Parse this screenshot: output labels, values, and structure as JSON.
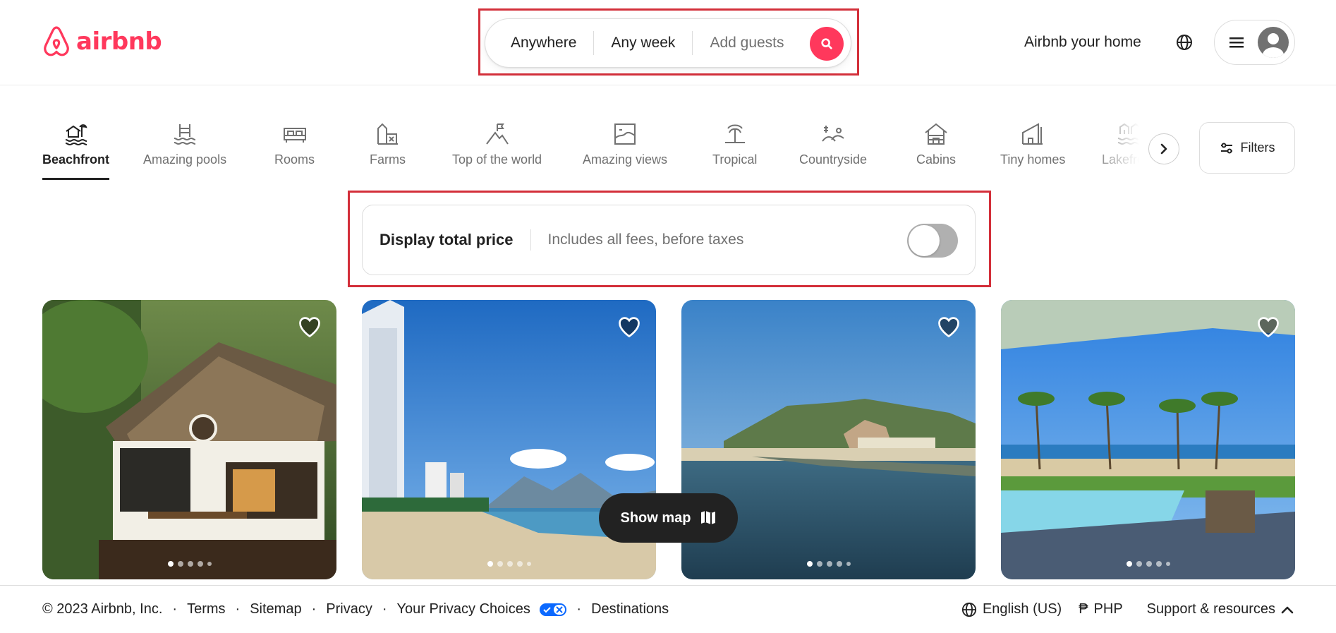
{
  "header": {
    "logo_text": "airbnb",
    "search": {
      "location": "Anywhere",
      "dates": "Any week",
      "guests": "Add guests"
    },
    "host_link": "Airbnb your home"
  },
  "categories": [
    {
      "label": "Beachfront",
      "icon": "beachfront-icon",
      "active": true
    },
    {
      "label": "Amazing pools",
      "icon": "pool-icon"
    },
    {
      "label": "Rooms",
      "icon": "bed-icon"
    },
    {
      "label": "Farms",
      "icon": "barn-icon"
    },
    {
      "label": "Top of the world",
      "icon": "mountain-flag-icon"
    },
    {
      "label": "Amazing views",
      "icon": "view-icon"
    },
    {
      "label": "Tropical",
      "icon": "palm-icon"
    },
    {
      "label": "Countryside",
      "icon": "countryside-icon"
    },
    {
      "label": "Cabins",
      "icon": "cabin-icon"
    },
    {
      "label": "Tiny homes",
      "icon": "tiny-home-icon"
    },
    {
      "label": "Lakefront",
      "icon": "lakefront-icon"
    }
  ],
  "filters_label": "Filters",
  "price_toggle": {
    "title": "Display total price",
    "subtitle": "Includes all fees, before taxes",
    "enabled": false
  },
  "listings": [
    {
      "image": "thatched-cottage-photo",
      "dots": 5
    },
    {
      "image": "beach-city-photo",
      "dots": 5
    },
    {
      "image": "bay-village-photo",
      "dots": 5
    },
    {
      "image": "pool-terrace-photo",
      "dots": 5
    }
  ],
  "show_map_label": "Show map",
  "footer": {
    "copyright": "© 2023 Airbnb, Inc.",
    "links": [
      "Terms",
      "Sitemap",
      "Privacy",
      "Your Privacy Choices",
      "Destinations"
    ],
    "language": "English (US)",
    "currency_symbol": "₱",
    "currency": "PHP",
    "support": "Support & resources"
  },
  "colors": {
    "brand": "#ff385c",
    "highlight_outline": "#d32f3a"
  }
}
